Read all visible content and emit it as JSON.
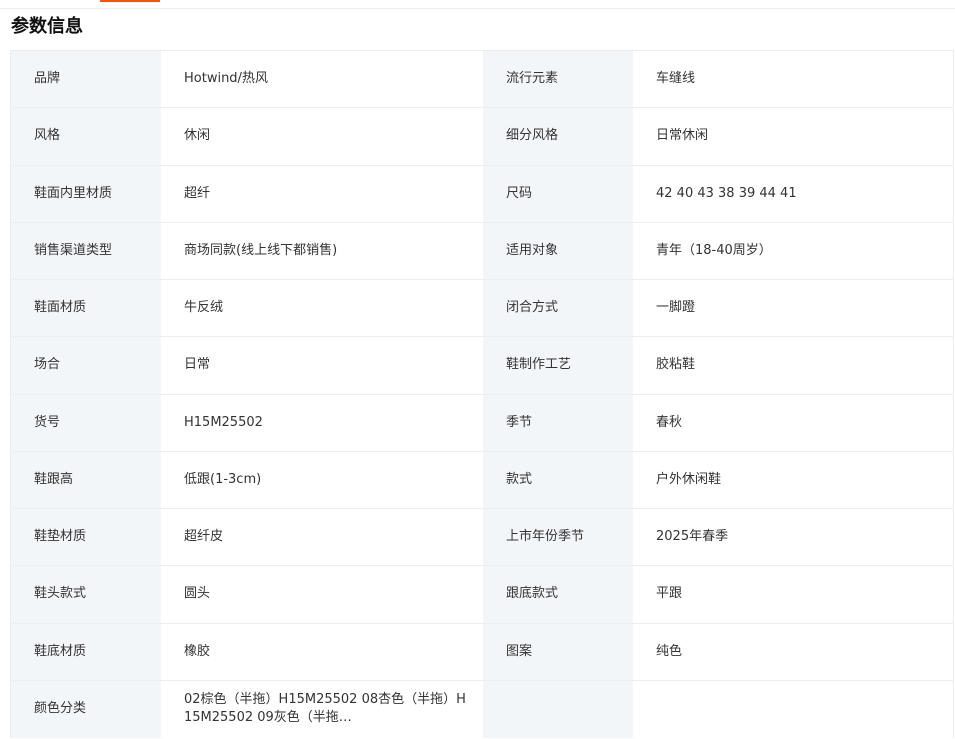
{
  "section_title": "参数信息",
  "rows": [
    {
      "k1": "品牌",
      "v1": "Hotwind/热风",
      "k2": "流行元素",
      "v2": "车缝线"
    },
    {
      "k1": "风格",
      "v1": "休闲",
      "k2": "细分风格",
      "v2": "日常休闲"
    },
    {
      "k1": "鞋面内里材质",
      "v1": "超纤",
      "k2": "尺码",
      "v2": "42 40 43 38 39 44 41"
    },
    {
      "k1": "销售渠道类型",
      "v1": "商场同款(线上线下都销售)",
      "k2": "适用对象",
      "v2": "青年（18-40周岁）"
    },
    {
      "k1": "鞋面材质",
      "v1": "牛反绒",
      "k2": "闭合方式",
      "v2": "一脚蹬"
    },
    {
      "k1": "场合",
      "v1": "日常",
      "k2": "鞋制作工艺",
      "v2": "胶粘鞋"
    },
    {
      "k1": "货号",
      "v1": "H15M25502",
      "k2": "季节",
      "v2": "春秋"
    },
    {
      "k1": "鞋跟高",
      "v1": "低跟(1-3cm)",
      "k2": "款式",
      "v2": "户外休闲鞋"
    },
    {
      "k1": "鞋垫材质",
      "v1": "超纤皮",
      "k2": "上市年份季节",
      "v2": "2025年春季"
    },
    {
      "k1": "鞋头款式",
      "v1": "圆头",
      "k2": "跟底款式",
      "v2": "平跟"
    },
    {
      "k1": "鞋底材质",
      "v1": "橡胶",
      "k2": "图案",
      "v2": "纯色"
    },
    {
      "k1": "颜色分类",
      "v1": "02棕色（半拖）H15M25502 08杏色（半拖）H15M25502 09灰色（半拖…",
      "k2": "",
      "v2": ""
    }
  ]
}
